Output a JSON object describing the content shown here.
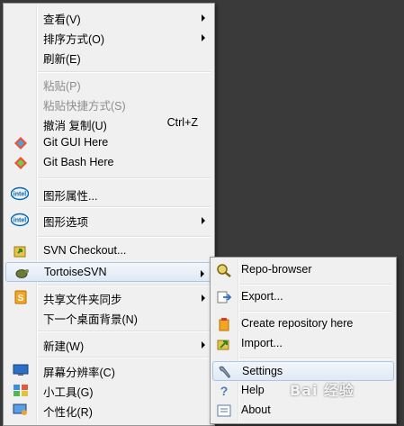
{
  "main_menu": {
    "items": [
      {
        "label": "查看(V)",
        "submenu": true
      },
      {
        "label": "排序方式(O)",
        "submenu": true
      },
      {
        "label": "刷新(E)"
      },
      {
        "label": "粘贴(P)",
        "disabled": true
      },
      {
        "label": "粘贴快捷方式(S)",
        "disabled": true
      },
      {
        "label": "撤消 复制(U)",
        "shortcut": "Ctrl+Z"
      },
      {
        "label": "Git GUI Here",
        "icon": "git-gui-icon"
      },
      {
        "label": "Git Bash Here",
        "icon": "git-bash-icon"
      },
      {
        "label": "图形属性...",
        "icon": "intel-graphics-icon"
      },
      {
        "label": "图形选项",
        "icon": "intel-graphics-icon",
        "submenu": true
      },
      {
        "label": "SVN Checkout...",
        "icon": "svn-checkout-icon"
      },
      {
        "label": "TortoiseSVN",
        "icon": "tortoisesvn-icon",
        "submenu": true,
        "highlighted": true
      },
      {
        "label": "共享文件夹同步",
        "icon": "sync-icon",
        "submenu": true
      },
      {
        "label": "下一个桌面背景(N)"
      },
      {
        "label": "新建(W)",
        "submenu": true
      },
      {
        "label": "屏幕分辨率(C)",
        "icon": "monitor-icon"
      },
      {
        "label": "小工具(G)",
        "icon": "gadgets-icon"
      },
      {
        "label": "个性化(R)",
        "icon": "personalize-icon"
      }
    ]
  },
  "svn_submenu": {
    "items": [
      {
        "label": "Repo-browser",
        "icon": "repo-browser-icon"
      },
      {
        "label": "Export...",
        "icon": "export-icon"
      },
      {
        "label": "Create repository here",
        "icon": "create-repo-icon"
      },
      {
        "label": "Import...",
        "icon": "import-icon"
      },
      {
        "label": "Settings",
        "icon": "settings-icon",
        "highlighted": true
      },
      {
        "label": "Help",
        "icon": "help-icon"
      },
      {
        "label": "About",
        "icon": "about-icon"
      }
    ]
  },
  "watermark": "Bai 经验",
  "colors": {
    "desktop": "#3a3a3a",
    "menu_bg": "#f0f0f0",
    "disabled_text": "#8d8d8d",
    "highlight_border": "#aec6e3"
  }
}
